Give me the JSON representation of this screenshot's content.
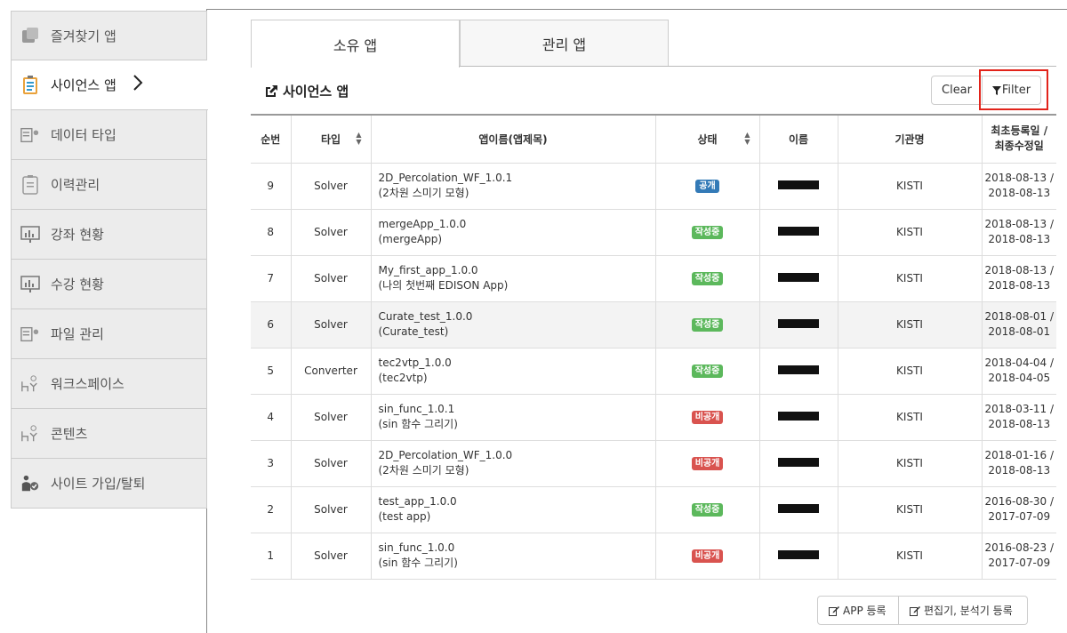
{
  "sidebar": {
    "items": [
      {
        "label": "즐겨찾기 앱",
        "icon": "favorites-app-icon"
      },
      {
        "label": "사이언스 앱",
        "icon": "science-app-icon",
        "active": true
      },
      {
        "label": "데이터 타입",
        "icon": "data-type-icon"
      },
      {
        "label": "이력관리",
        "icon": "history-icon"
      },
      {
        "label": "강좌 현황",
        "icon": "course-status-icon"
      },
      {
        "label": "수강 현황",
        "icon": "enrollment-status-icon"
      },
      {
        "label": "파일 관리",
        "icon": "file-manage-icon"
      },
      {
        "label": "워크스페이스",
        "icon": "workspace-icon"
      },
      {
        "label": "콘텐츠",
        "icon": "contents-icon"
      },
      {
        "label": "사이트 가입/탈퇴",
        "icon": "site-join-icon"
      }
    ]
  },
  "tabs": [
    {
      "label": "소유 앱",
      "active": true
    },
    {
      "label": "관리 앱",
      "active": false
    }
  ],
  "section": {
    "title": "사이언스 앱",
    "clear_label": "Clear",
    "filter_label": "Filter"
  },
  "table": {
    "headers": [
      "순번",
      "타입",
      "앱이름(앱제목)",
      "상태",
      "이름",
      "기관명",
      "최초등록일 /",
      "최종수정일"
    ],
    "rows": [
      {
        "no": "9",
        "type": "Solver",
        "name1": "2D_Percolation_WF_1.0.1",
        "name2": "(2차원 스미기 모형)",
        "status": "공개",
        "status_color": "#337ab7",
        "org": "KISTI",
        "d1": "2018-08-13 /",
        "d2": "2018-08-13"
      },
      {
        "no": "8",
        "type": "Solver",
        "name1": "mergeApp_1.0.0",
        "name2": "(mergeApp)",
        "status": "작성중",
        "status_color": "#5cb85c",
        "org": "KISTI",
        "d1": "2018-08-13 /",
        "d2": "2018-08-13"
      },
      {
        "no": "7",
        "type": "Solver",
        "name1": "My_first_app_1.0.0",
        "name2": "(나의 첫번째 EDISON App)",
        "status": "작성중",
        "status_color": "#5cb85c",
        "org": "KISTI",
        "d1": "2018-08-13 /",
        "d2": "2018-08-13"
      },
      {
        "no": "6",
        "type": "Solver",
        "name1": "Curate_test_1.0.0",
        "name2": "(Curate_test)",
        "status": "작성중",
        "status_color": "#5cb85c",
        "org": "KISTI",
        "d1": "2018-08-01 /",
        "d2": "2018-08-01"
      },
      {
        "no": "5",
        "type": "Converter",
        "name1": "tec2vtp_1.0.0",
        "name2": "(tec2vtp)",
        "status": "작성중",
        "status_color": "#5cb85c",
        "org": "KISTI",
        "d1": "2018-04-04 /",
        "d2": "2018-04-05"
      },
      {
        "no": "4",
        "type": "Solver",
        "name1": "sin_func_1.0.1",
        "name2": "(sin 함수 그리기)",
        "status": "비공개",
        "status_color": "#d9534f",
        "org": "KISTI",
        "d1": "2018-03-11 /",
        "d2": "2018-08-13"
      },
      {
        "no": "3",
        "type": "Solver",
        "name1": "2D_Percolation_WF_1.0.0",
        "name2": "(2차원 스미기 모형)",
        "status": "비공개",
        "status_color": "#d9534f",
        "org": "KISTI",
        "d1": "2018-01-16 /",
        "d2": "2018-08-13"
      },
      {
        "no": "2",
        "type": "Solver",
        "name1": "test_app_1.0.0",
        "name2": "(test app)",
        "status": "작성중",
        "status_color": "#5cb85c",
        "org": "KISTI",
        "d1": "2016-08-30 /",
        "d2": "2017-07-09"
      },
      {
        "no": "1",
        "type": "Solver",
        "name1": "sin_func_1.0.0",
        "name2": "(sin 함수 그리기)",
        "status": "비공개",
        "status_color": "#d9534f",
        "org": "KISTI",
        "d1": "2016-08-23 /",
        "d2": "2017-07-09"
      }
    ]
  },
  "bottom": {
    "app_register": "APP 등록",
    "editor_register": "편집기, 분석기 등록"
  }
}
